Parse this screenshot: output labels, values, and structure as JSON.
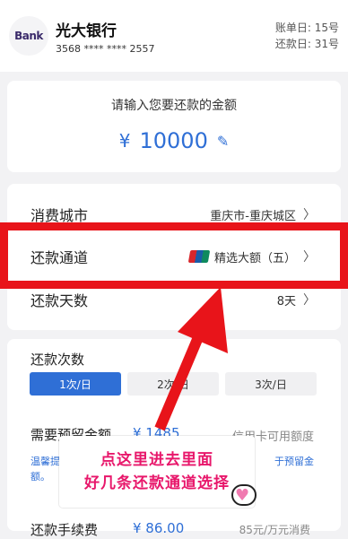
{
  "header": {
    "logo_text": "Bank",
    "bank_name": "光大银行",
    "card_number": "3568 **** **** 2557",
    "bill_day": "账单日: 15号",
    "repay_day": "还款日: 31号"
  },
  "amount": {
    "prompt": "请输入您要还款的金额",
    "currency": "¥",
    "value": "10000"
  },
  "settings": {
    "city_label": "消费城市",
    "city_value": "重庆市-重庆城区",
    "channel_label": "还款通道",
    "channel_value": "精选大额（五）",
    "days_label": "还款天数",
    "days_value": "8天"
  },
  "frequency": {
    "title": "还款次数",
    "options": [
      "1次/日",
      "2次/日",
      "3次/日"
    ],
    "selected_index": 0
  },
  "reserve": {
    "label": "需要预留金额",
    "value": "¥ 1485",
    "credit_label": "信用卡可用额度",
    "tip": "温馨提示：请确保信用卡可用额度不低于预留金额。",
    "tip_left_l1": "温馨提",
    "tip_left_l2": "额。",
    "tip_right": "于预留金"
  },
  "fee": {
    "label": "还款手续费",
    "value": "¥ 86.00",
    "rate": "85元/万元消费"
  },
  "overlay": {
    "line1": "点这里进去里面",
    "line2": "好几条还款通道选择"
  },
  "colors": {
    "accent_blue": "#2f6fd6",
    "highlight_red": "#e8141a",
    "annotation_pink": "#e8176b"
  }
}
